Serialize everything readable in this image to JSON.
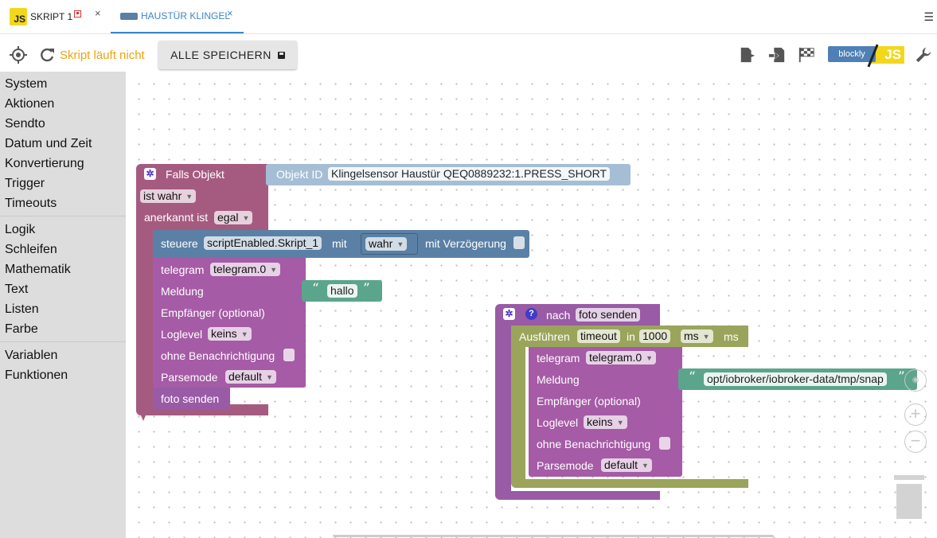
{
  "tabs": [
    {
      "label": "SKRIPT 1",
      "close": "×"
    },
    {
      "label": "HAUSTÜR KLINGEL",
      "close": "×"
    }
  ],
  "toolbar": {
    "status": "Skript läuft nicht",
    "save_label": "ALLE SPEICHERN",
    "blockly_label": "blockly",
    "js_label": "JS"
  },
  "categories": {
    "group1": [
      "System",
      "Aktionen",
      "Sendto",
      "Datum und Zeit",
      "Konvertierung",
      "Trigger",
      "Timeouts"
    ],
    "group2": [
      "Logik",
      "Schleifen",
      "Mathematik",
      "Text",
      "Listen",
      "Farbe"
    ],
    "group3": [
      "Variablen",
      "Funktionen"
    ]
  },
  "blocks": {
    "trigger": {
      "title": "Falls Objekt",
      "objid_label": "Objekt ID",
      "objid_value": "Klingelsensor Haustür QEQ0889232:1.PRESS_SHORT",
      "condition": "ist wahr",
      "ack_label": "anerkannt ist",
      "ack_value": "egal"
    },
    "control": {
      "label": "steuere",
      "target": "scriptEnabled.Skript_1",
      "with_label": "mit",
      "value": "wahr",
      "delay_label": "mit Verzögerung"
    },
    "telegram1": {
      "label": "telegram",
      "instance": "telegram.0",
      "message_label": "Meldung",
      "message_text": "hallo",
      "recipient_label": "Empfänger (optional)",
      "loglevel_label": "Loglevel",
      "loglevel_value": "keins",
      "silent_label": "ohne Benachrichtigung",
      "parse_label": "Parsemode",
      "parse_value": "default"
    },
    "call": {
      "label": "foto senden"
    },
    "func": {
      "label": "nach",
      "name": "foto senden"
    },
    "timeout": {
      "label": "Ausführen",
      "name": "timeout",
      "in_label": "in",
      "value": "1000",
      "unit": "ms",
      "unit_label": "ms"
    },
    "telegram2": {
      "label": "telegram",
      "instance": "telegram.0",
      "message_label": "Meldung",
      "message_text": "opt/iobroker/iobroker-data/tmp/snap",
      "recipient_label": "Empfänger (optional)",
      "loglevel_label": "Loglevel",
      "loglevel_value": "keins",
      "silent_label": "ohne Benachrichtigung",
      "parse_label": "Parsemode",
      "parse_value": "default"
    }
  },
  "zoom": {
    "in": "+",
    "out": "−"
  },
  "colors": {
    "event": "#a55b80",
    "control": "#5b80a5",
    "telegram": "#a55ba5",
    "function": "#995ba5",
    "timeout": "#9aa55b",
    "text": "#5ba58c",
    "objid": "#a5bed6",
    "status": "#f0a30a"
  }
}
